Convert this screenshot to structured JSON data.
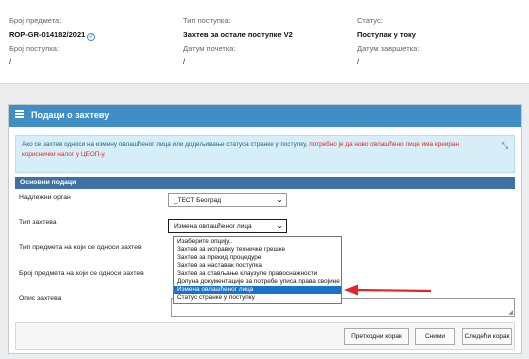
{
  "summary": {
    "case_number_label": "Број предмета:",
    "case_number": "ROP-GR-014182/2021",
    "procedure_type_label": "Тип поступка:",
    "procedure_type": "Захтев за остале поступке V2",
    "status_label": "Статус:",
    "status": "Поступак у току",
    "procedure_number_label": "Број поступка:",
    "procedure_number": "/",
    "start_date_label": "Датум почетка:",
    "start_date": "/",
    "end_date_label": "Датум завршетка:",
    "end_date": "/"
  },
  "panel": {
    "title": "Подаци о захтеву",
    "info_text_1": "Ако се захтев односи на измену овлашћеног лица или додељивање статуса странке у поступку, ",
    "info_text_red": "потребно је да ново овлашћено лице има креиран кориснички налог у ЦЕОП-у.",
    "section_title": "Основни подаци"
  },
  "form": {
    "authority_label": "Надлежни орган",
    "authority_value": "_ТЕСТ Београд",
    "request_type_label": "Тип захтева",
    "request_type_value": "Измена овлашћеног лица",
    "subject_type_label": "Тип предмета на који се односи захтев",
    "subject_number_label": "Број предмета на који се односи захтев",
    "description_label": "Опис захтева"
  },
  "dropdown": {
    "options": [
      "Изаберите опцију..",
      "Захтев за исправку техничке грешке",
      "Захтев за прекид процедуре",
      "Захтев за наставак поступка",
      "Захтев за стављање клаузуле правоснажности",
      "Допуна документације за потребе уписа права својине",
      "Измена овлашћеног лица",
      "Статус странке у поступку"
    ],
    "selected_index": 6
  },
  "buttons": {
    "previous": "Претходни корак",
    "save": "Сними",
    "next": "Следећи корак"
  },
  "colors": {
    "panel_header": "#3f8fc6",
    "section_bar": "#3f72a4",
    "selected_option": "#1a73c9",
    "annotation_arrow": "#e0252b",
    "warning_text": "#e22222"
  }
}
